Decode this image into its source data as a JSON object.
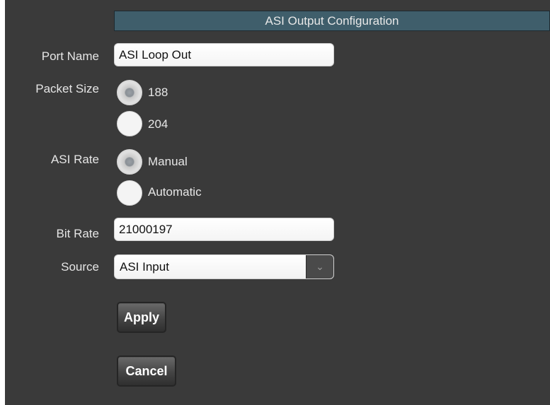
{
  "title": "ASI Output Configuration",
  "fields": {
    "port_name": {
      "label": "Port Name",
      "value": "ASI Loop Out"
    },
    "packet_size": {
      "label": "Packet Size",
      "options": [
        "188",
        "204"
      ],
      "selected": "188"
    },
    "asi_rate": {
      "label": "ASI Rate",
      "options": [
        "Manual",
        "Automatic"
      ],
      "selected": "Manual"
    },
    "bit_rate": {
      "label": "Bit Rate",
      "value": "21000197"
    },
    "source": {
      "label": "Source",
      "value": "ASI Input"
    }
  },
  "buttons": {
    "apply": "Apply",
    "cancel": "Cancel"
  },
  "icons": {
    "dropdown": "chevron-down-icon"
  },
  "colors": {
    "panel_bg": "#3a3a3a",
    "title_bar": "#3f5e6b"
  }
}
